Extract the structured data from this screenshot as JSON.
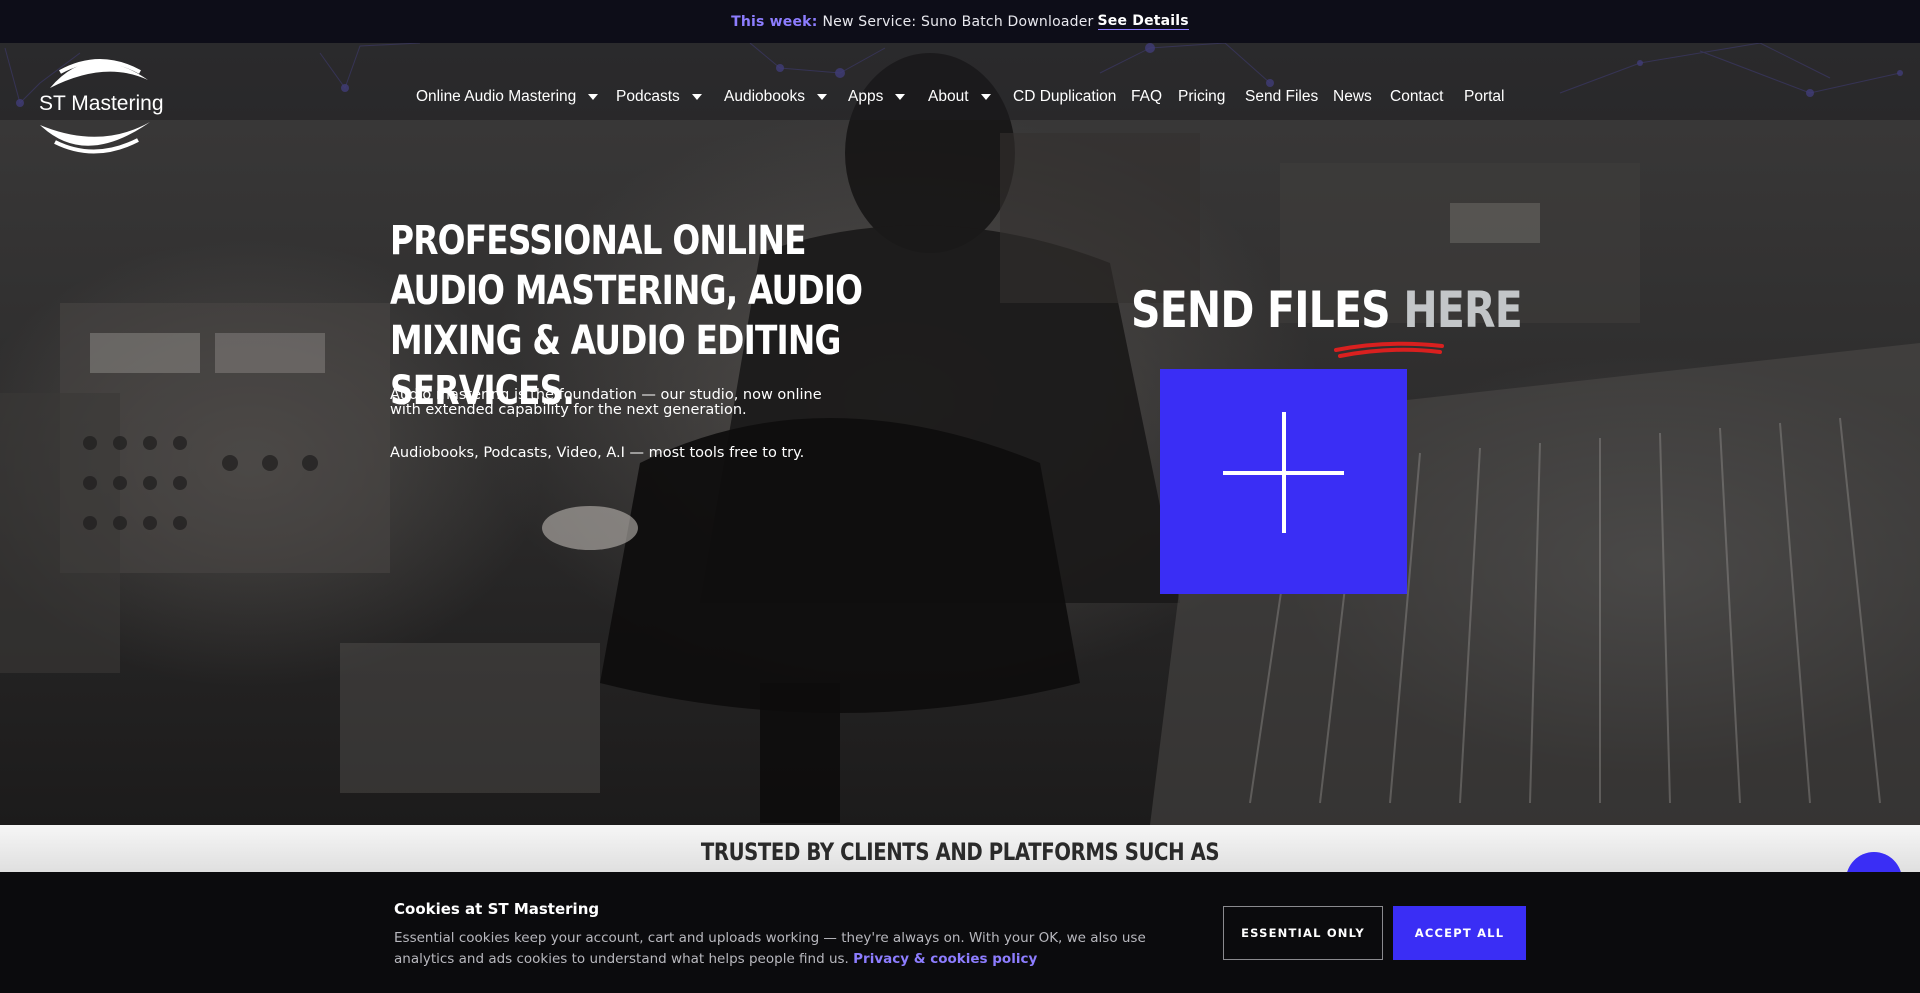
{
  "announcement": {
    "label": "This week:",
    "message": "New Service: Suno Batch Downloader",
    "link": "See Details"
  },
  "logo": {
    "text": "ST Mastering"
  },
  "nav": {
    "items": [
      {
        "label": "Online Audio Mastering",
        "dropdown": true
      },
      {
        "label": "Podcasts",
        "dropdown": true
      },
      {
        "label": "Audiobooks",
        "dropdown": true
      },
      {
        "label": "Apps",
        "dropdown": true
      },
      {
        "label": "About",
        "dropdown": true
      },
      {
        "label": "CD Duplication",
        "dropdown": false
      },
      {
        "label": "FAQ",
        "dropdown": false
      },
      {
        "label": "Pricing",
        "dropdown": false
      },
      {
        "label": "Send Files",
        "dropdown": false
      },
      {
        "label": "News",
        "dropdown": false
      },
      {
        "label": "Contact",
        "dropdown": false
      },
      {
        "label": "Portal",
        "dropdown": false
      }
    ]
  },
  "hero": {
    "headline": "Professional online audio mastering, audio mixing & audio editing services.",
    "subtext": "Audio mastering is the foundation — our studio, now online with extended capability for the next generation.",
    "subtext2": "Audiobooks, Podcasts, Video, A.I — most tools free to try.",
    "send_title": "SEND FILES",
    "send_highlight": "HERE",
    "upload_icon": "plus-icon"
  },
  "trusted": {
    "title": "TRUSTED BY CLIENTS AND PLATFORMS SUCH AS"
  },
  "cookie": {
    "title": "Cookies at ST Mastering",
    "text": "Essential cookies keep your account, cart and uploads working — they're always on. With your OK, we also use analytics and ads cookies to understand what helps people find us.",
    "policy_link": "Privacy & cookies policy",
    "essential_button": "ESSENTIAL ONLY",
    "accept_button": "ACCEPT ALL"
  },
  "colors": {
    "accent": "#3a2ef5",
    "accent_light": "#8d7dff",
    "underline": "#d9201f"
  }
}
